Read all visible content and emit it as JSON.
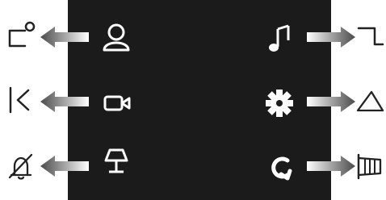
{
  "colors": {
    "panel_background": "#1b1b1b",
    "page_background": "#ffffff",
    "screen_icon": "#ffffff",
    "diagram_icon": "#222222",
    "arrow_light": "#ffffff",
    "arrow_dark": "#4a4a4a"
  },
  "screen_buttons": {
    "left": [
      "user-icon",
      "camera-icon",
      "lamp-icon"
    ],
    "right": [
      "music-note-icon",
      "gear-icon",
      "refresh-icon"
    ]
  },
  "targets": {
    "left": [
      "window-corner-dot-icon",
      "left-angle-bracket-icon",
      "bell-off-icon"
    ],
    "right": [
      "step-line-icon",
      "triangle-icon",
      "projector-screen-icon"
    ]
  }
}
